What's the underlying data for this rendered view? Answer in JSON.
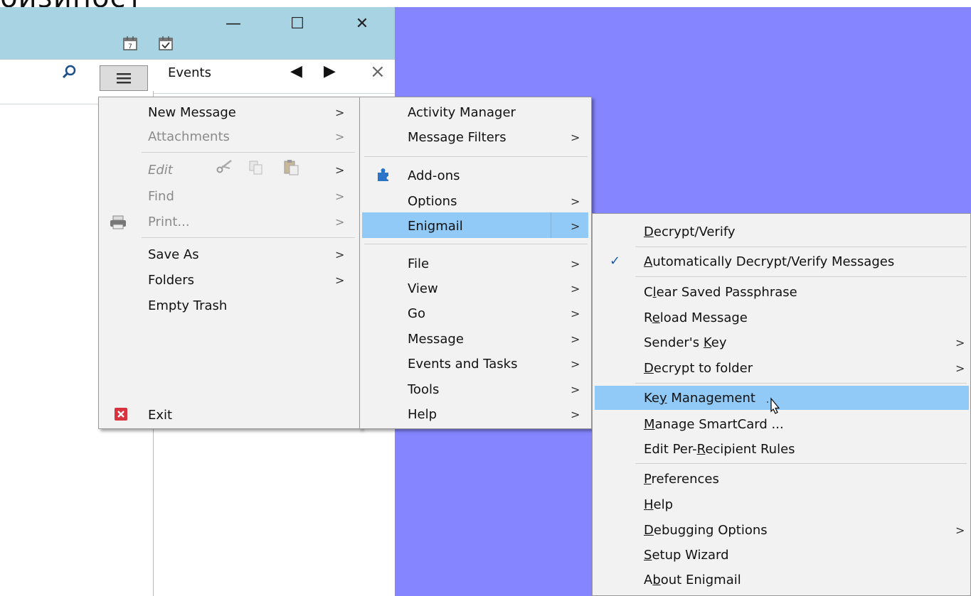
{
  "page": {
    "cropped_title": "бизиност"
  },
  "window": {
    "controls": {
      "minimize": "—",
      "maximize": "☐",
      "close": "✕"
    }
  },
  "events_pane": {
    "title": "Events",
    "prev": "◀",
    "next": "▶",
    "close": "×"
  },
  "main_menu": {
    "items": [
      {
        "label": "New Message",
        "enabled": true,
        "submenu": true
      },
      {
        "label": "Attachments",
        "enabled": false,
        "submenu": true
      },
      {
        "label": "Edit",
        "enabled": false,
        "submenu": true
      },
      {
        "label": "Find",
        "enabled": false,
        "submenu": true
      },
      {
        "label": "Print...",
        "enabled": false,
        "submenu": true
      },
      {
        "label": "Save As",
        "enabled": true,
        "submenu": true
      },
      {
        "label": "Folders",
        "enabled": true,
        "submenu": true
      },
      {
        "label": "Empty Trash",
        "enabled": true,
        "submenu": false
      },
      {
        "label": "Exit",
        "enabled": true,
        "submenu": false
      }
    ]
  },
  "app_menu": {
    "items": [
      {
        "label": "Activity Manager",
        "submenu": false
      },
      {
        "label": "Message Filters",
        "submenu": true
      },
      {
        "label": "Add-ons",
        "submenu": false
      },
      {
        "label": "Options",
        "submenu": true
      },
      {
        "label": "Enigmail",
        "submenu": true,
        "highlighted": true
      },
      {
        "label": "File",
        "submenu": true
      },
      {
        "label": "View",
        "submenu": true
      },
      {
        "label": "Go",
        "submenu": true
      },
      {
        "label": "Message",
        "submenu": true
      },
      {
        "label": "Events and Tasks",
        "submenu": true
      },
      {
        "label": "Tools",
        "submenu": true
      },
      {
        "label": "Help",
        "submenu": true
      }
    ]
  },
  "enigmail_menu": {
    "items": [
      {
        "pre": "",
        "key": "D",
        "post": "ecrypt/Verify"
      },
      {
        "pre": "",
        "key": "A",
        "post": "utomatically Decrypt/Verify Messages",
        "checked": true
      },
      {
        "pre": "C",
        "key": "l",
        "post": "ear Saved Passphrase"
      },
      {
        "pre": "R",
        "key": "e",
        "post": "load Message"
      },
      {
        "pre": "Sender's ",
        "key": "K",
        "post": "ey",
        "submenu": true
      },
      {
        "pre": "",
        "key": "D",
        "post": "ecrypt to folder",
        "submenu": true
      },
      {
        "pre": "Ke",
        "key": "y",
        "post": " Management",
        "highlighted": true
      },
      {
        "pre": "",
        "key": "M",
        "post": "anage SmartCard ..."
      },
      {
        "pre": "Edit Per-",
        "key": "R",
        "post": "ecipient Rules"
      },
      {
        "pre": "",
        "key": "P",
        "post": "references"
      },
      {
        "pre": "",
        "key": "H",
        "post": "elp"
      },
      {
        "pre": "",
        "key": "D",
        "post": "ebugging Options",
        "submenu": true
      },
      {
        "pre": "",
        "key": "S",
        "post": "etup Wizard"
      },
      {
        "pre": "A",
        "key": "b",
        "post": "out Enigmail"
      }
    ]
  },
  "colors": {
    "title_bar": "#a7d3e3",
    "desktop": "#8585ff",
    "highlight": "#91c9f7",
    "menu_bg": "#f2f2f2"
  },
  "submenu_arrow": ">",
  "checkmark": "✓"
}
